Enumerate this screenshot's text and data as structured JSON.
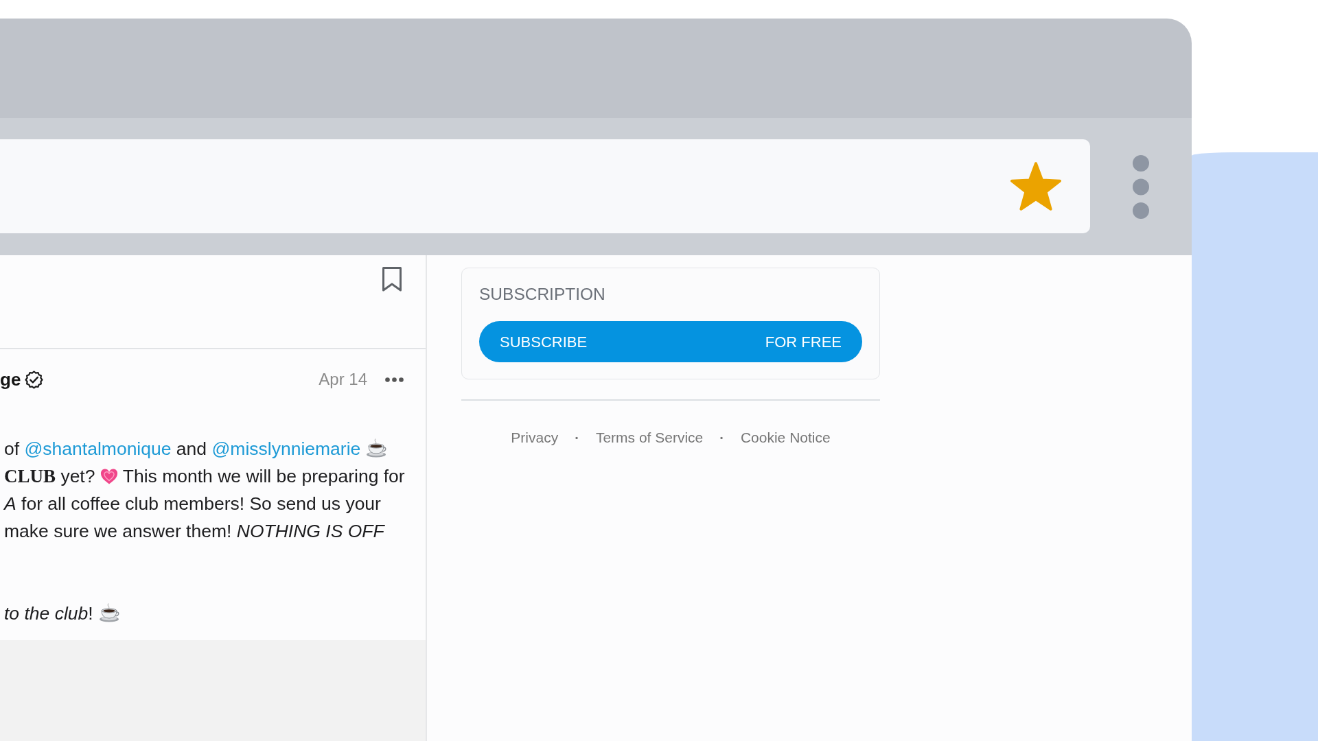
{
  "address_bar": {
    "starred": true
  },
  "post": {
    "author": "ge",
    "verified": true,
    "date": "Apr 14",
    "paragraphs": [
      [
        [
          {
            "kind": "text",
            "text": "of "
          },
          {
            "kind": "mention",
            "text": "@shantalmonique"
          },
          {
            "kind": "text",
            "text": " and "
          },
          {
            "kind": "mention",
            "text": "@misslynniemarie"
          },
          {
            "kind": "cup"
          }
        ],
        [
          {
            "kind": "text",
            "text": "**CLUB** yet? "
          },
          {
            "kind": "heart"
          },
          {
            "kind": "text",
            "text": " This month we will be preparing for"
          }
        ],
        [
          {
            "kind": "text",
            "text": "*A* for all coffee club members! So send us your"
          }
        ],
        [
          {
            "kind": "text",
            "text": "make sure we answer them! *NOTHING IS OFF*"
          }
        ]
      ],
      [
        [
          {
            "kind": "text",
            "text": "*to the club*!"
          },
          {
            "kind": "cup"
          }
        ]
      ]
    ]
  },
  "subscription": {
    "title": "SUBSCRIPTION",
    "button": {
      "label": "SUBSCRIBE",
      "price": "FOR FREE"
    }
  },
  "footer": {
    "links": [
      "Privacy",
      "Terms of Service",
      "Cookie Notice"
    ],
    "separator": "·"
  }
}
